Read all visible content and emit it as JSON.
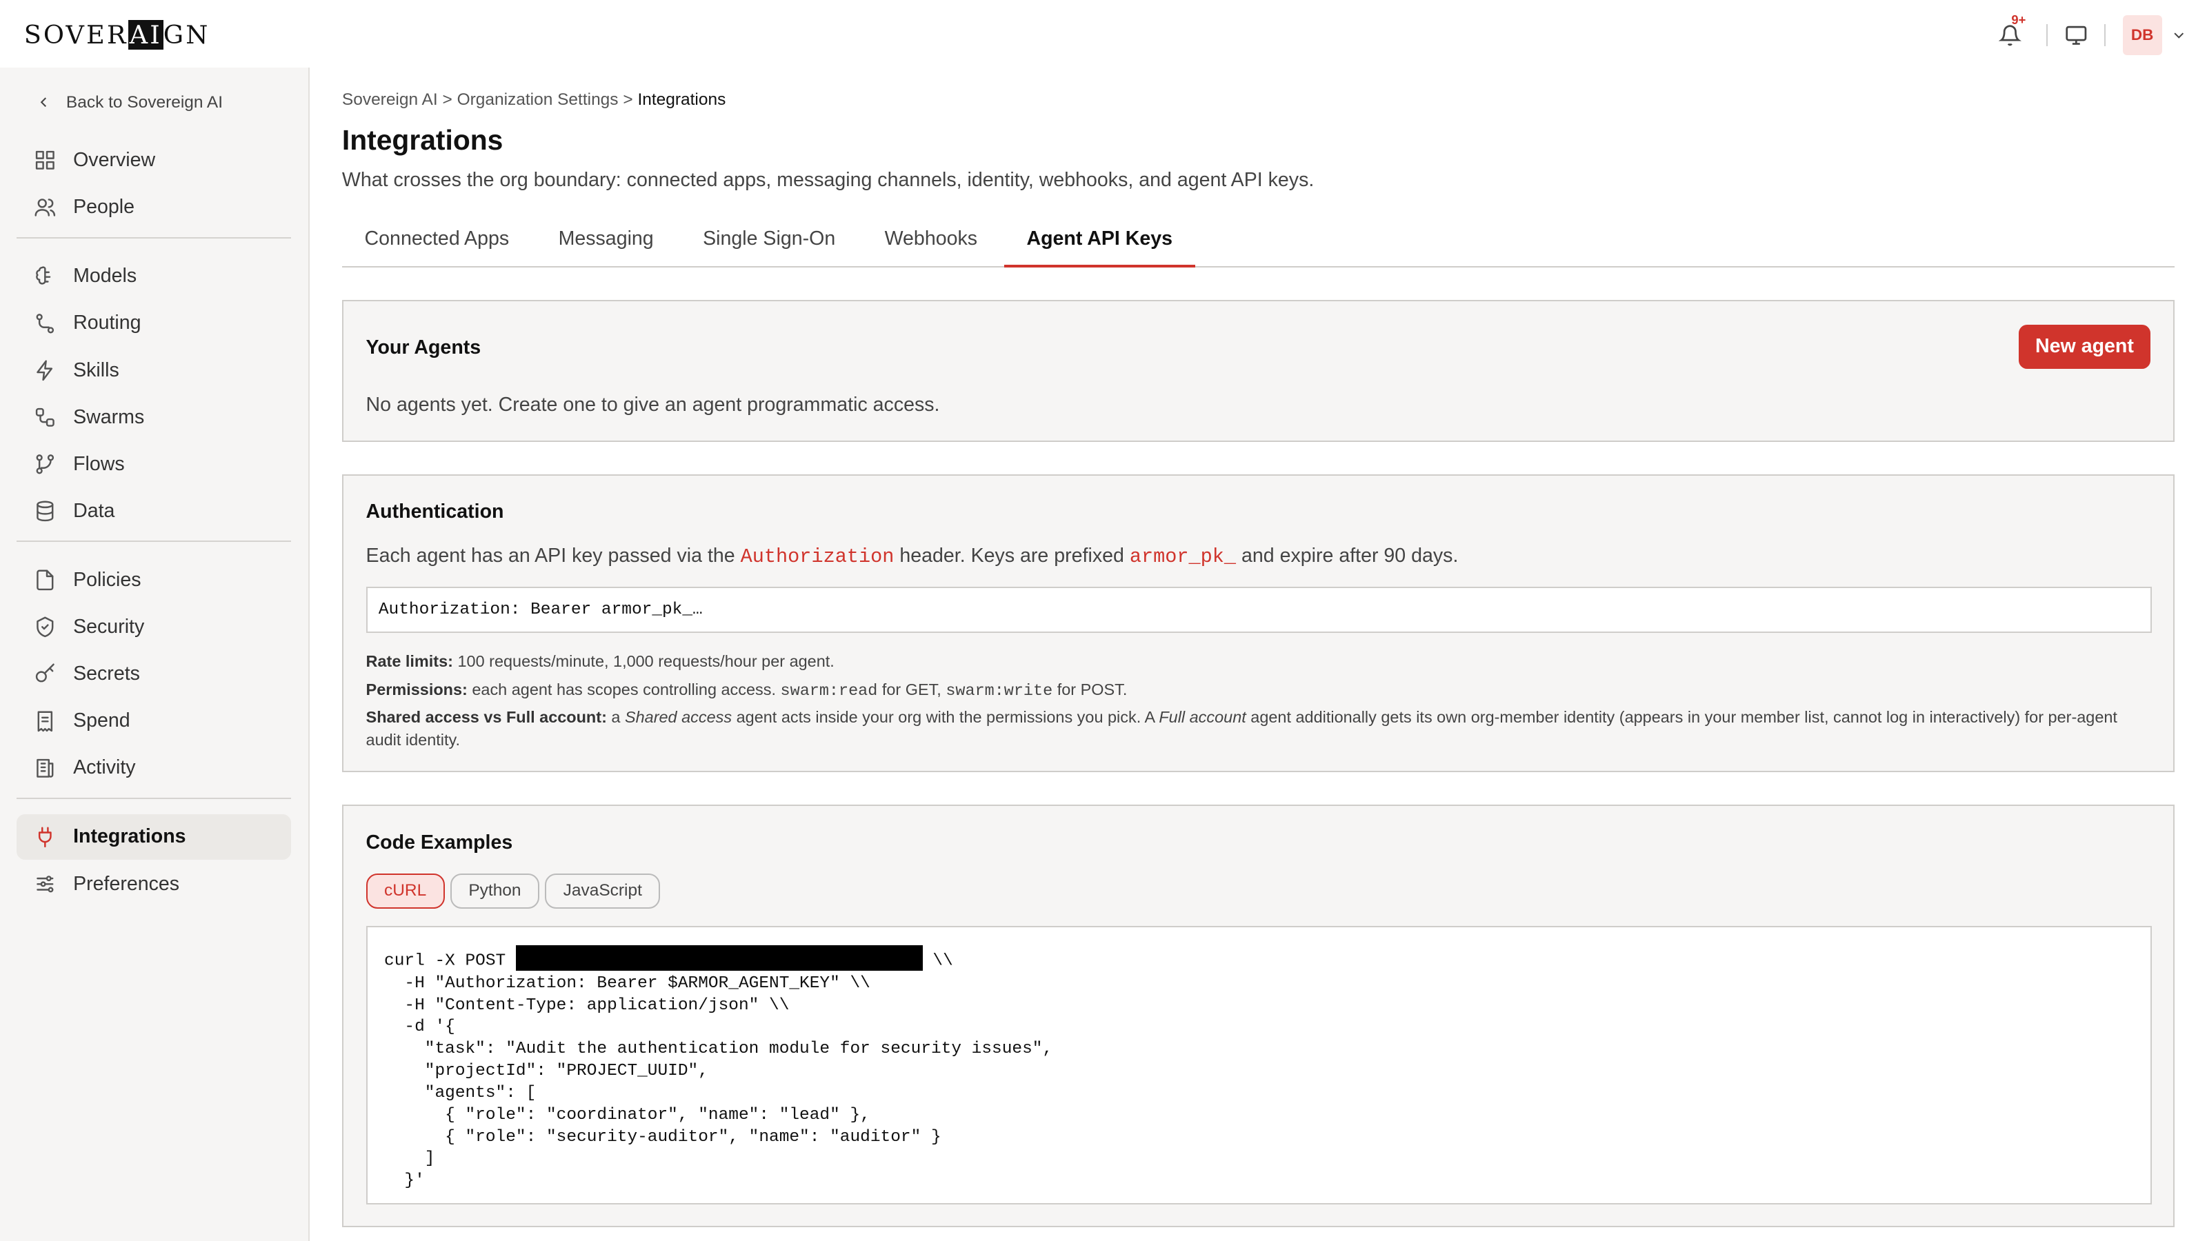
{
  "app": {
    "logo_pre": "SOVER",
    "logo_hl": "AI",
    "logo_post": "GN",
    "notif_badge": "9+",
    "avatar_initials": "DB"
  },
  "sidebar": {
    "back_label": "Back to Sovereign AI",
    "groups": [
      [
        {
          "label": "Overview",
          "icon": "grid-icon"
        },
        {
          "label": "People",
          "icon": "people-icon"
        }
      ],
      [
        {
          "label": "Models",
          "icon": "brain-icon"
        },
        {
          "label": "Routing",
          "icon": "route-icon"
        },
        {
          "label": "Skills",
          "icon": "bolt-icon"
        },
        {
          "label": "Swarms",
          "icon": "swarm-icon"
        },
        {
          "label": "Flows",
          "icon": "branch-icon"
        },
        {
          "label": "Data",
          "icon": "database-icon"
        }
      ],
      [
        {
          "label": "Policies",
          "icon": "document-icon"
        },
        {
          "label": "Security",
          "icon": "shield-icon"
        },
        {
          "label": "Secrets",
          "icon": "key-icon"
        },
        {
          "label": "Spend",
          "icon": "receipt-icon"
        },
        {
          "label": "Activity",
          "icon": "log-icon"
        }
      ],
      [
        {
          "label": "Integrations",
          "icon": "plug-icon",
          "active": true
        },
        {
          "label": "Preferences",
          "icon": "sliders-icon"
        }
      ]
    ]
  },
  "breadcrumb": {
    "root": "Sovereign AI",
    "sep": ">",
    "mid": "Organization Settings",
    "current": "Integrations"
  },
  "page": {
    "title": "Integrations",
    "subtitle": "What crosses the org boundary: connected apps, messaging channels, identity, webhooks, and agent API keys."
  },
  "tabs": [
    "Connected Apps",
    "Messaging",
    "Single Sign-On",
    "Webhooks",
    "Agent API Keys"
  ],
  "agents_card": {
    "title": "Your Agents",
    "button": "New agent",
    "empty": "No agents yet. Create one to give an agent programmatic access."
  },
  "auth_card": {
    "title": "Authentication",
    "desc_1": "Each agent has an API key passed via the ",
    "desc_code1": "Authorization",
    "desc_2": " header. Keys are prefixed ",
    "desc_code2": "armor_pk_",
    "desc_3": " and expire after 90 days.",
    "header_example": "Authorization: Bearer armor_pk_…",
    "rate_label": "Rate limits:",
    "rate_text": " 100 requests/minute, 1,000 requests/hour per agent.",
    "perm_label": "Permissions:",
    "perm_text_1": " each agent has scopes controlling access. ",
    "perm_code1": "swarm:read",
    "perm_text_2": " for GET, ",
    "perm_code2": "swarm:write",
    "perm_text_3": " for POST.",
    "shared_label": "Shared access vs Full account:",
    "shared_text_1": " a ",
    "shared_em1": "Shared access",
    "shared_text_2": " agent acts inside your org with the permissions you pick. A ",
    "shared_em2": "Full account",
    "shared_text_3": " agent additionally gets its own org-member identity (appears in your member list, cannot log in interactively) for per-agent audit identity."
  },
  "code_card": {
    "title": "Code Examples",
    "langs": [
      "cURL",
      "Python",
      "JavaScript"
    ],
    "active_lang": "cURL",
    "first_line_pre": "curl -X POST ",
    "first_line_post": " \\\\",
    "code_rest": "  -H \"Authorization: Bearer $ARMOR_AGENT_KEY\" \\\\\n  -H \"Content-Type: application/json\" \\\\\n  -d '{\n    \"task\": \"Audit the authentication module for security issues\",\n    \"projectId\": \"PROJECT_UUID\",\n    \"agents\": [\n      { \"role\": \"coordinator\", \"name\": \"lead\" },\n      { \"role\": \"security-auditor\", \"name\": \"auditor\" }\n    ]\n  }'"
  },
  "colors": {
    "accent": "#d0342c",
    "sidebar_bg": "#f6f5f4",
    "card_bg": "#f6f5f4"
  }
}
